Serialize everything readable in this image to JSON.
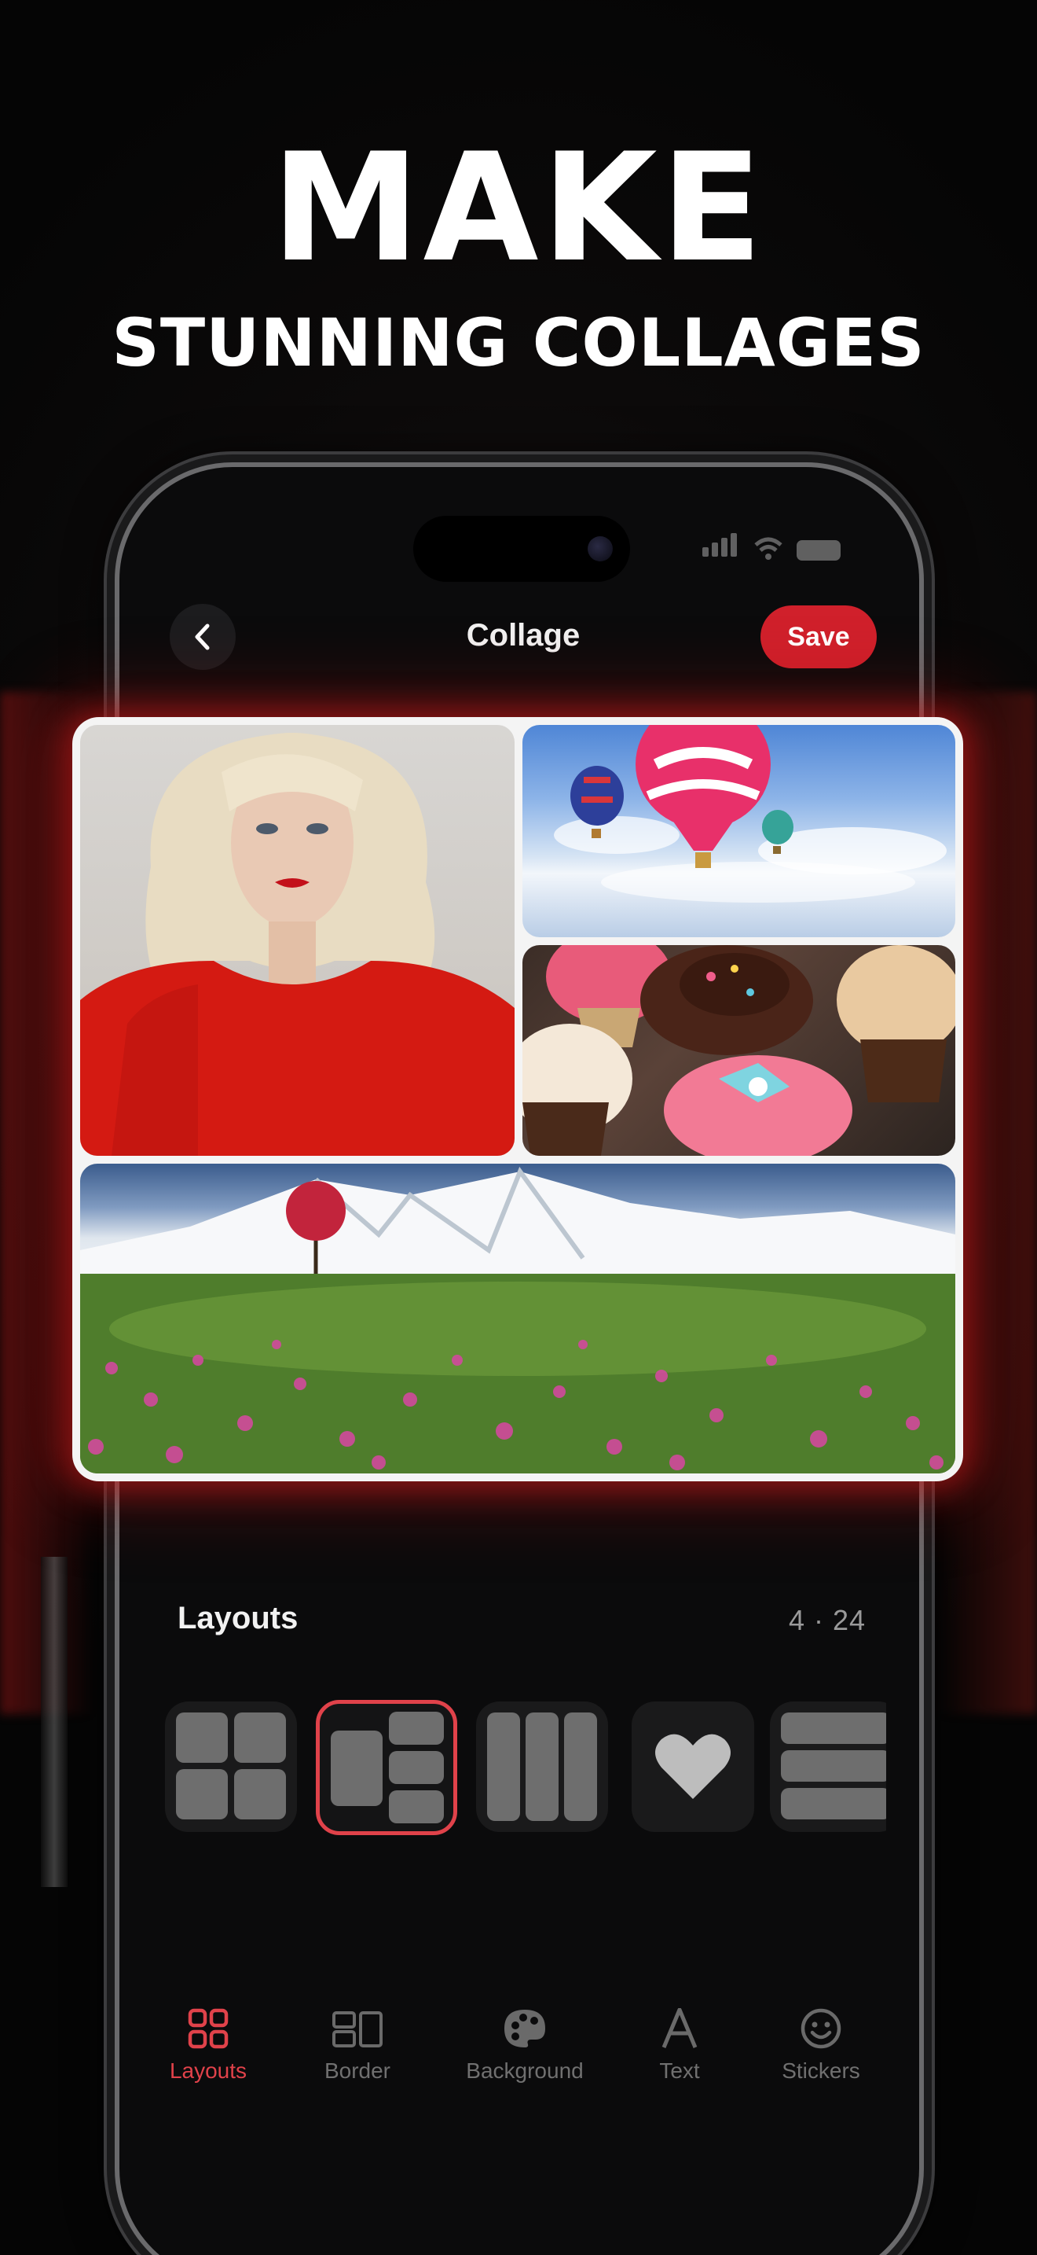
{
  "headline": {
    "line1": "MAKE",
    "line2": "STUNNING COLLAGES"
  },
  "nav": {
    "title": "Collage",
    "save_label": "Save"
  },
  "collage": {
    "cells": [
      "portrait",
      "hot-air-balloons",
      "cupcakes",
      "mountain-meadow"
    ]
  },
  "panel": {
    "title": "Layouts",
    "count": "4 · 24"
  },
  "layouts": [
    {
      "name": "grid-2x2",
      "selected": false
    },
    {
      "name": "one-plus-three",
      "selected": true
    },
    {
      "name": "three-columns",
      "selected": false
    },
    {
      "name": "heart",
      "selected": false
    },
    {
      "name": "three-rows",
      "selected": false
    }
  ],
  "tabs": [
    {
      "label": "Layouts",
      "icon": "grid-icon",
      "active": true
    },
    {
      "label": "Border",
      "icon": "border-icon",
      "active": false
    },
    {
      "label": "Background",
      "icon": "palette-icon",
      "active": false
    },
    {
      "label": "Text",
      "icon": "text-icon",
      "active": false
    },
    {
      "label": "Stickers",
      "icon": "smiley-icon",
      "active": false
    }
  ],
  "colors": {
    "accent": "#d0202b",
    "accent_light": "#e0424a",
    "background": "#070707"
  }
}
